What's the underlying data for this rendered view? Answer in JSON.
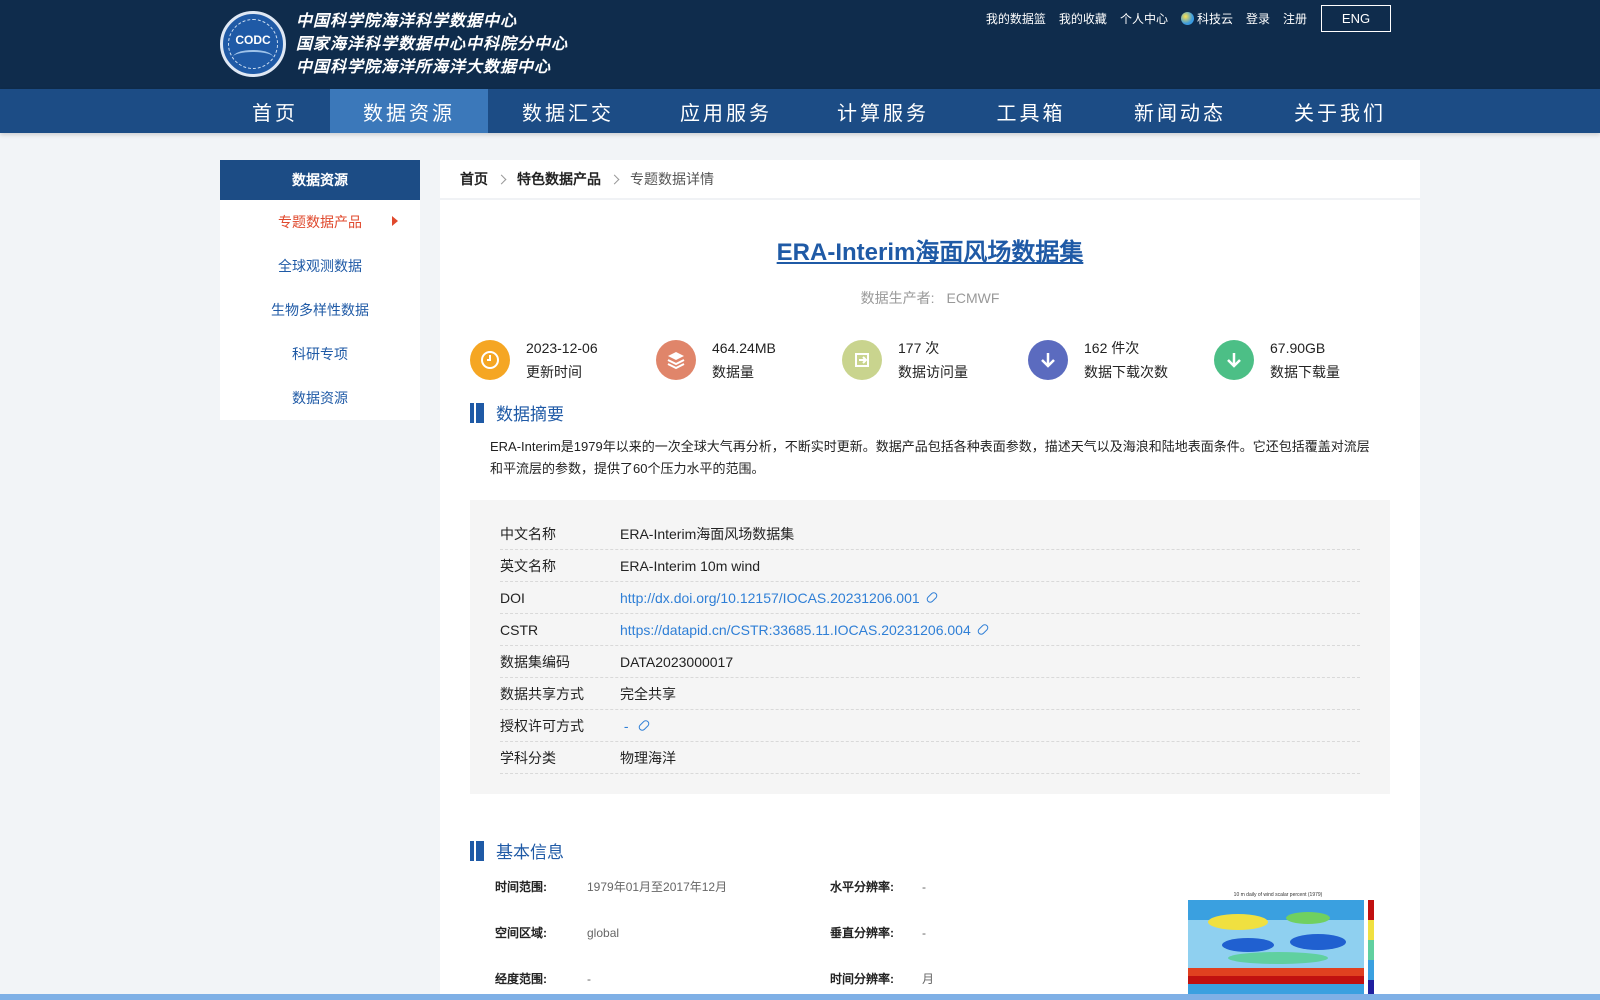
{
  "header": {
    "logo_text": "CODC",
    "titles": [
      "中国科学院海洋科学数据中心",
      "国家海洋科学数据中心中科院分中心",
      "中国科学院海洋所海洋大数据中心"
    ],
    "toplinks": [
      "我的数据篮",
      "我的收藏",
      "个人中心",
      "科技云",
      "登录",
      "注册"
    ],
    "lang_button": "ENG",
    "nav": [
      "首页",
      "数据资源",
      "数据汇交",
      "应用服务",
      "计算服务",
      "工具箱",
      "新闻动态",
      "关于我们"
    ],
    "nav_active": "数据资源"
  },
  "sidebar": {
    "title": "数据资源",
    "items": [
      "专题数据产品",
      "全球观测数据",
      "生物多样性数据",
      "科研专项",
      "数据资源"
    ],
    "active": "专题数据产品"
  },
  "breadcrumb": [
    "首页",
    "特色数据产品",
    "专题数据详情"
  ],
  "dataset": {
    "title": "ERA-Interim海面风场数据集",
    "producer_label": "数据生产者:",
    "producer": "ECMWF"
  },
  "stats": [
    {
      "value": "2023-12-06",
      "label": "更新时间",
      "icon": "clock-icon",
      "color": "#f5a623"
    },
    {
      "value": "464.24MB",
      "label": "数据量",
      "icon": "layers-icon",
      "color": "#e0856a"
    },
    {
      "value": "177 次",
      "label": "数据访问量",
      "icon": "login-icon",
      "color": "#c9d48e"
    },
    {
      "value": "162 件次",
      "label": "数据下载次数",
      "icon": "download-icon",
      "color": "#5b6bbf"
    },
    {
      "value": "67.90GB",
      "label": "数据下载量",
      "icon": "download-icon",
      "color": "#4cbf86"
    }
  ],
  "abstract": {
    "heading": "数据摘要",
    "text": "ERA-Interim是1979年以来的一次全球大气再分析，不断实时更新。数据产品包括各种表面参数，描述天气以及海浪和陆地表面条件。它还包括覆盖对流层和平流层的参数，提供了60个压力水平的范围。"
  },
  "meta": [
    {
      "key": "中文名称",
      "value": "ERA-Interim海面风场数据集"
    },
    {
      "key": "英文名称",
      "value": "ERA-Interim 10m wind"
    },
    {
      "key": "DOI",
      "value": "http://dx.doi.org/10.12157/IOCAS.20231206.001",
      "link": true
    },
    {
      "key": "CSTR",
      "value": "https://datapid.cn/CSTR:33685.11.IOCAS.20231206.004",
      "link": true
    },
    {
      "key": "数据集编码",
      "value": "DATA2023000017"
    },
    {
      "key": "数据共享方式",
      "value": "完全共享"
    },
    {
      "key": "授权许可方式",
      "value": " - ",
      "link": true
    },
    {
      "key": "学科分类",
      "value": "物理海洋"
    }
  ],
  "basic": {
    "heading": "基本信息",
    "rows": [
      {
        "key": "时间范围:",
        "value": "1979年01月至2017年12月"
      },
      {
        "key": "空间区域:",
        "value": "global"
      },
      {
        "key": "经度范围:",
        "value": "-"
      },
      {
        "key": "水平分辨率:",
        "value": "-"
      },
      {
        "key": "垂直分辨率:",
        "value": "-"
      },
      {
        "key": "时间分辨率:",
        "value": "月"
      }
    ],
    "thumbnail_caption": "10 m daily of wind scalar percent (1979)"
  },
  "colors": {
    "header_bg": "#0f2c4c",
    "nav_bg": "#1c4c85",
    "nav_active": "#3b78ba",
    "accent": "#1f5aa6",
    "sidebar_active": "#e0492d",
    "link": "#2f7fd6"
  }
}
